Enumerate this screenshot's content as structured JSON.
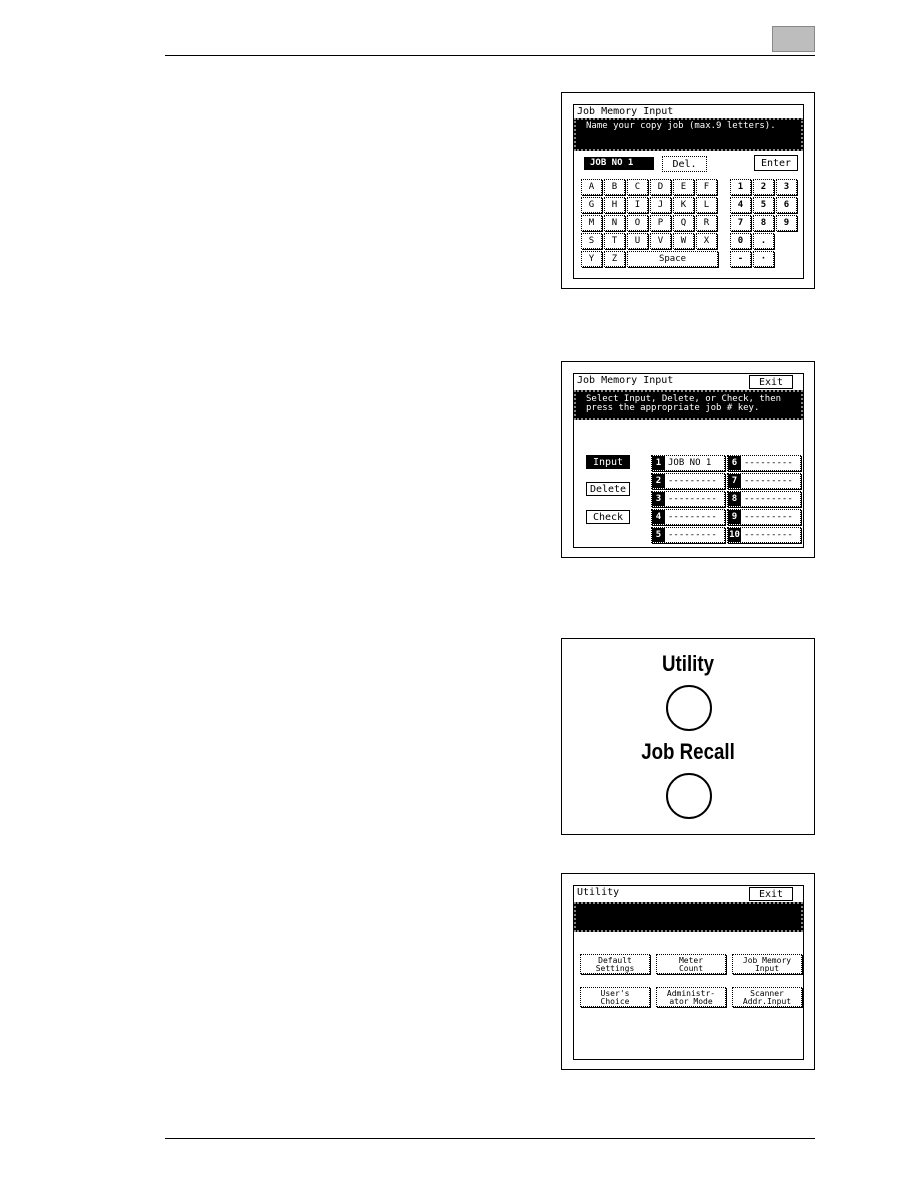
{
  "panel1": {
    "title": "Job Memory Input",
    "message": "Name your copy job (max.9 letters).",
    "name_value": "JOB NO 1",
    "del": "Del.",
    "enter": "Enter",
    "letters": [
      [
        "A",
        "B",
        "C",
        "D",
        "E",
        "F"
      ],
      [
        "G",
        "H",
        "I",
        "J",
        "K",
        "L"
      ],
      [
        "M",
        "N",
        "O",
        "P",
        "Q",
        "R"
      ],
      [
        "S",
        "T",
        "U",
        "V",
        "W",
        "X"
      ],
      [
        "Y",
        "Z"
      ]
    ],
    "space": "Space",
    "digits": [
      [
        "1",
        "2",
        "3"
      ],
      [
        "4",
        "5",
        "6"
      ],
      [
        "7",
        "8",
        "9"
      ],
      [
        "0",
        "."
      ],
      [
        "-",
        "·"
      ]
    ]
  },
  "panel2": {
    "title": "Job Memory Input",
    "exit": "Exit",
    "message_line1": "Select Input, Delete, or Check, then",
    "message_line2": "press the appropriate job # key.",
    "modes": [
      "Input",
      "Delete",
      "Check"
    ],
    "selected_mode": "Input",
    "slots": [
      {
        "n": "1",
        "v": "JOB NO 1"
      },
      {
        "n": "2",
        "v": "---------"
      },
      {
        "n": "3",
        "v": "---------"
      },
      {
        "n": "4",
        "v": "---------"
      },
      {
        "n": "5",
        "v": "---------"
      },
      {
        "n": "6",
        "v": "---------"
      },
      {
        "n": "7",
        "v": "---------"
      },
      {
        "n": "8",
        "v": "---------"
      },
      {
        "n": "9",
        "v": "---------"
      },
      {
        "n": "10",
        "v": "---------"
      }
    ]
  },
  "panel3": {
    "utility": "Utility",
    "job_recall": "Job Recall"
  },
  "panel4": {
    "title": "Utility",
    "exit": "Exit",
    "buttons": [
      [
        "Default",
        "Settings"
      ],
      [
        "Meter",
        "Count"
      ],
      [
        "Job Memory",
        "Input"
      ],
      [
        "User's",
        "Choice"
      ],
      [
        "Administr-",
        "ator Mode"
      ],
      [
        "Scanner",
        "Addr.Input"
      ]
    ]
  }
}
